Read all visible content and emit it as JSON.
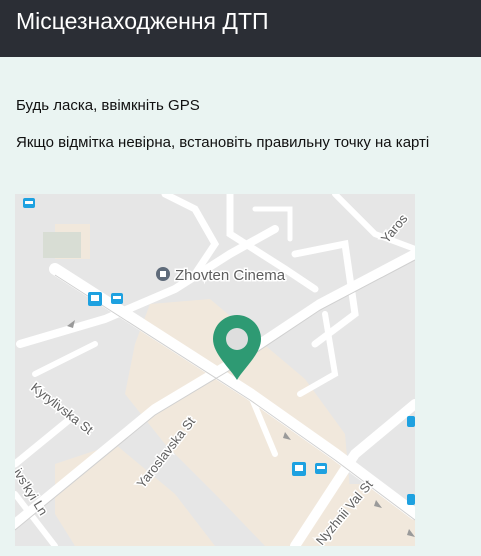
{
  "header": {
    "title": "Місцезнаходження ДТП"
  },
  "messages": {
    "gps_prompt": "Будь ласка, ввімкніть GPS",
    "correct_point_hint": "Якщо відмітка невірна, встановіть правильну точку на карті"
  },
  "map": {
    "poi": "Zhovten Cinema",
    "streets": {
      "kyrylivska": "Kyrylivska St",
      "yaroslavska": "Yaroslavska St",
      "nyzhnii_val": "Nyzhnii Val St",
      "yaro_cut": "Yaros",
      "kyivskyi_cut": "ivs'kyi Ln"
    },
    "marker_icon": "location-pin-icon",
    "colors": {
      "marker": "#2e9a73",
      "block": "#f1e8dc",
      "road": "#ffffff",
      "background": "#e6e6e6",
      "transit": "#1ea1e0"
    }
  }
}
